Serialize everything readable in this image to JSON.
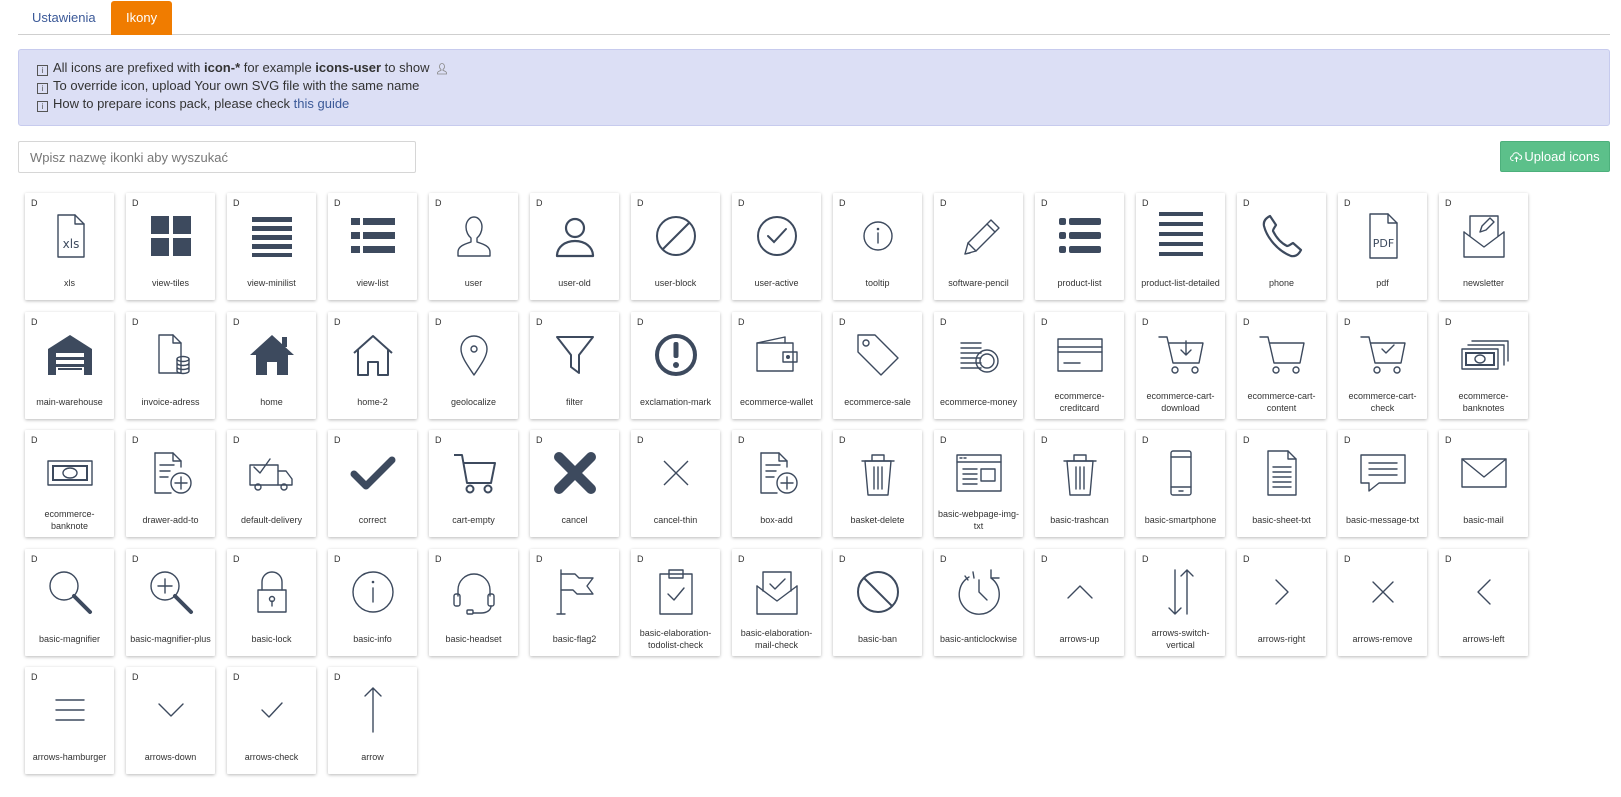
{
  "tabs": [
    {
      "label": "Ustawienia",
      "active": false
    },
    {
      "label": "Ikony",
      "active": true
    }
  ],
  "info": {
    "line1_prefix": "All icons are prefixed with ",
    "line1_bold1": "icon-*",
    "line1_mid": " for example ",
    "line1_bold2": "icons-user",
    "line1_suffix": " to show",
    "line2": "To override icon, upload Your own SVG file with the same name",
    "line3_prefix": "How to prepare icons pack, please check ",
    "line3_link": "this guide",
    "info_glyph": "i"
  },
  "search": {
    "placeholder": "Wpisz nazwę ikonki aby wyszukać",
    "value": ""
  },
  "upload": {
    "label": "Upload icons",
    "color": "#5cc08a"
  },
  "colors": {
    "accent": "#f07c00",
    "icon": "#3d4a5e",
    "link": "#3b5998",
    "info_bg": "#dcdff5"
  },
  "badge": "D",
  "icons": [
    {
      "name": "xls",
      "icon": "xls"
    },
    {
      "name": "view-tiles",
      "icon": "view-tiles"
    },
    {
      "name": "view-minilist",
      "icon": "view-minilist"
    },
    {
      "name": "view-list",
      "icon": "view-list"
    },
    {
      "name": "user",
      "icon": "user"
    },
    {
      "name": "user-old",
      "icon": "user-old"
    },
    {
      "name": "user-block",
      "icon": "user-block"
    },
    {
      "name": "user-active",
      "icon": "user-active"
    },
    {
      "name": "tooltip",
      "icon": "tooltip"
    },
    {
      "name": "software-pencil",
      "icon": "software-pencil"
    },
    {
      "name": "product-list",
      "icon": "product-list"
    },
    {
      "name": "product-list-detailed",
      "icon": "product-list-detailed"
    },
    {
      "name": "phone",
      "icon": "phone"
    },
    {
      "name": "pdf",
      "icon": "pdf"
    },
    {
      "name": "newsletter",
      "icon": "newsletter"
    },
    {
      "name": "main-warehouse",
      "icon": "main-warehouse"
    },
    {
      "name": "invoice-adress",
      "icon": "invoice-adress"
    },
    {
      "name": "home",
      "icon": "home"
    },
    {
      "name": "home-2",
      "icon": "home-2"
    },
    {
      "name": "geolocalize",
      "icon": "geolocalize"
    },
    {
      "name": "filter",
      "icon": "filter"
    },
    {
      "name": "exclamation-mark",
      "icon": "exclamation-mark"
    },
    {
      "name": "ecommerce-wallet",
      "icon": "ecommerce-wallet"
    },
    {
      "name": "ecommerce-sale",
      "icon": "ecommerce-sale"
    },
    {
      "name": "ecommerce-money",
      "icon": "ecommerce-money"
    },
    {
      "name": "ecommerce-creditcard",
      "icon": "ecommerce-creditcard"
    },
    {
      "name": "ecommerce-cart-download",
      "icon": "ecommerce-cart-download"
    },
    {
      "name": "ecommerce-cart-content",
      "icon": "ecommerce-cart-content"
    },
    {
      "name": "ecommerce-cart-check",
      "icon": "ecommerce-cart-check"
    },
    {
      "name": "ecommerce-banknotes",
      "icon": "ecommerce-banknotes"
    },
    {
      "name": "ecommerce-banknote",
      "icon": "ecommerce-banknote"
    },
    {
      "name": "drawer-add-to",
      "icon": "drawer-add-to"
    },
    {
      "name": "default-delivery",
      "icon": "default-delivery"
    },
    {
      "name": "correct",
      "icon": "correct"
    },
    {
      "name": "cart-empty",
      "icon": "cart-empty"
    },
    {
      "name": "cancel",
      "icon": "cancel"
    },
    {
      "name": "cancel-thin",
      "icon": "cancel-thin"
    },
    {
      "name": "box-add",
      "icon": "box-add"
    },
    {
      "name": "basket-delete",
      "icon": "basket-delete"
    },
    {
      "name": "basic-webpage-img-txt",
      "icon": "basic-webpage-img-txt"
    },
    {
      "name": "basic-trashcan",
      "icon": "basic-trashcan"
    },
    {
      "name": "basic-smartphone",
      "icon": "basic-smartphone"
    },
    {
      "name": "basic-sheet-txt",
      "icon": "basic-sheet-txt"
    },
    {
      "name": "basic-message-txt",
      "icon": "basic-message-txt"
    },
    {
      "name": "basic-mail",
      "icon": "basic-mail"
    },
    {
      "name": "basic-magnifier",
      "icon": "basic-magnifier"
    },
    {
      "name": "basic-magnifier-plus",
      "icon": "basic-magnifier-plus"
    },
    {
      "name": "basic-lock",
      "icon": "basic-lock"
    },
    {
      "name": "basic-info",
      "icon": "basic-info"
    },
    {
      "name": "basic-headset",
      "icon": "basic-headset"
    },
    {
      "name": "basic-flag2",
      "icon": "basic-flag2"
    },
    {
      "name": "basic-elaboration-todolist-check",
      "icon": "basic-elaboration-todolist-check"
    },
    {
      "name": "basic-elaboration-mail-check",
      "icon": "basic-elaboration-mail-check"
    },
    {
      "name": "basic-ban",
      "icon": "basic-ban"
    },
    {
      "name": "basic-anticlockwise",
      "icon": "basic-anticlockwise"
    },
    {
      "name": "arrows-up",
      "icon": "arrows-up"
    },
    {
      "name": "arrows-switch-vertical",
      "icon": "arrows-switch-vertical"
    },
    {
      "name": "arrows-right",
      "icon": "arrows-right"
    },
    {
      "name": "arrows-remove",
      "icon": "arrows-remove"
    },
    {
      "name": "arrows-left",
      "icon": "arrows-left"
    },
    {
      "name": "arrows-hamburger",
      "icon": "arrows-hamburger"
    },
    {
      "name": "arrows-down",
      "icon": "arrows-down"
    },
    {
      "name": "arrows-check",
      "icon": "arrows-check"
    },
    {
      "name": "arrow",
      "icon": "arrow"
    }
  ]
}
